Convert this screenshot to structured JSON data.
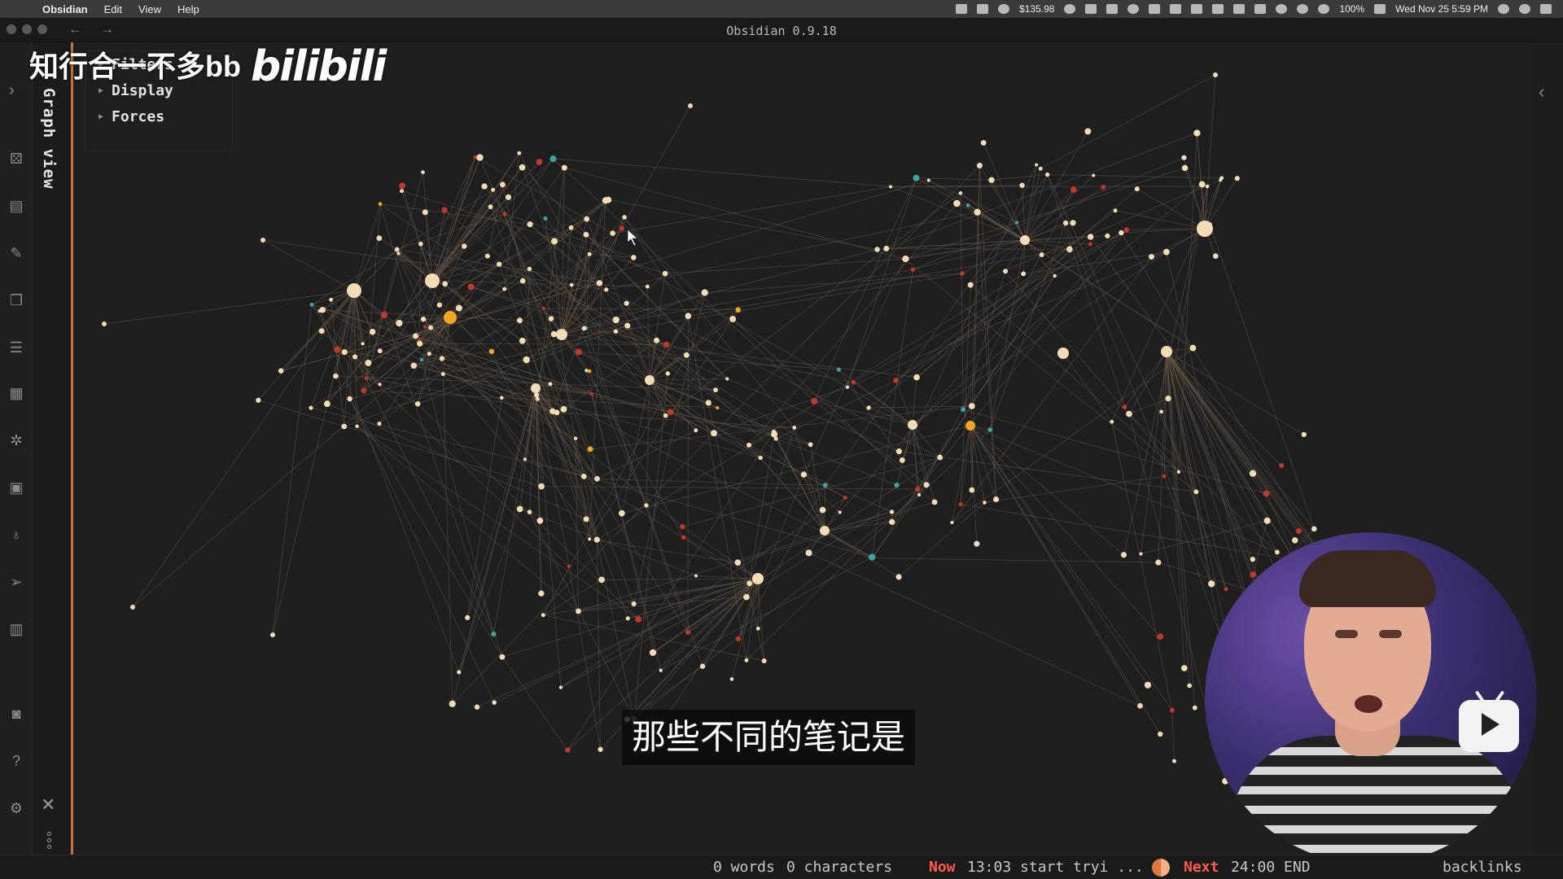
{
  "menubar": {
    "app_name": "Obsidian",
    "menus": [
      "Edit",
      "View",
      "Help"
    ],
    "price": "$135.98",
    "battery": "100%",
    "datetime": "Wed Nov 25  5:59 PM"
  },
  "window": {
    "title": "Obsidian 0.9.18",
    "back_arrow": "←",
    "forward_arrow": "→"
  },
  "ribbon": {
    "icons": [
      "graph-icon",
      "table-icon",
      "pencil-icon",
      "copy-icon",
      "list-icon",
      "document-icon",
      "network-icon",
      "calendar-icon",
      "microphone-icon",
      "send-icon",
      "grid-icon",
      "camera-icon",
      "help-icon",
      "gear-icon"
    ]
  },
  "side_panel": {
    "tab_label": "Graph view",
    "close": "✕"
  },
  "graph_controls": {
    "items": [
      {
        "label": "Filters",
        "expanded": false
      },
      {
        "label": "Display",
        "expanded": false
      },
      {
        "label": "Forces",
        "expanded": false
      }
    ]
  },
  "watermark": {
    "text": "知行合一不多bb",
    "logo": "bilibili"
  },
  "subtitle": "那些不同的笔记是",
  "statusbar": {
    "words": "0 words",
    "characters": "0 characters",
    "now_label": "Now",
    "now_text": "13:03 start tryi ...",
    "next_label": "Next",
    "next_text": "24:00 END",
    "backlinks": "backlinks"
  },
  "colors": {
    "node": "#f2dcb6",
    "node_accent": "#f5a623",
    "node_red": "#c0392b",
    "node_teal": "#3aa6a6",
    "edge": "#6b5a4c",
    "panel_accent": "#c8703a"
  }
}
